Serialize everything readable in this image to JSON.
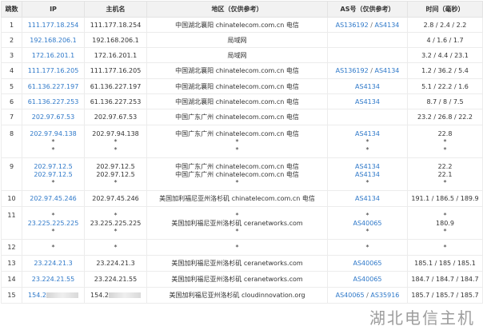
{
  "headers": [
    "跳数",
    "IP",
    "主机名",
    "地区（仅供参考）",
    "AS号（仅供参考）",
    "时间（毫秒）"
  ],
  "rows": [
    {
      "hop": "1",
      "ips": [
        "111.177.18.254"
      ],
      "hosts": [
        "111.177.18.254"
      ],
      "regions": [
        "中国湖北襄阳 chinatelecom.com.cn 电信"
      ],
      "as_lines": [
        [
          "AS136192",
          "AS4134"
        ]
      ],
      "times": [
        "2.8 / 2.4 / 2.2"
      ]
    },
    {
      "hop": "2",
      "ips": [
        "192.168.206.1"
      ],
      "hosts": [
        "192.168.206.1"
      ],
      "regions": [
        "局域网"
      ],
      "as_lines": [],
      "times": [
        "4 / 1.6 / 1.7"
      ]
    },
    {
      "hop": "3",
      "ips": [
        "172.16.201.1"
      ],
      "hosts": [
        "172.16.201.1"
      ],
      "regions": [
        "局域网"
      ],
      "as_lines": [],
      "times": [
        "3.2 / 4.4 / 23.1"
      ]
    },
    {
      "hop": "4",
      "ips": [
        "111.177.16.205"
      ],
      "hosts": [
        "111.177.16.205"
      ],
      "regions": [
        "中国湖北襄阳 chinatelecom.com.cn 电信"
      ],
      "as_lines": [
        [
          "AS136192",
          "AS4134"
        ]
      ],
      "times": [
        "1.2 / 36.2 / 5.4"
      ]
    },
    {
      "hop": "5",
      "ips": [
        "61.136.227.197"
      ],
      "hosts": [
        "61.136.227.197"
      ],
      "regions": [
        "中国湖北襄阳 chinatelecom.com.cn 电信"
      ],
      "as_lines": [
        [
          "AS4134"
        ]
      ],
      "times": [
        "5.1 / 22.2 / 1.6"
      ]
    },
    {
      "hop": "6",
      "ips": [
        "61.136.227.253"
      ],
      "hosts": [
        "61.136.227.253"
      ],
      "regions": [
        "中国湖北襄阳 chinatelecom.com.cn 电信"
      ],
      "as_lines": [
        [
          "AS4134"
        ]
      ],
      "times": [
        "8.7 / 8 / 7.5"
      ]
    },
    {
      "hop": "7",
      "ips": [
        "202.97.67.53"
      ],
      "hosts": [
        "202.97.67.53"
      ],
      "regions": [
        "中国广东广州 chinatelecom.com.cn 电信"
      ],
      "as_lines": [],
      "times": [
        "23.2 / 26.8 / 22.2"
      ]
    },
    {
      "hop": "8",
      "ips": [
        "202.97.94.138",
        "*",
        "*"
      ],
      "hosts": [
        "202.97.94.138",
        "*",
        "*"
      ],
      "regions": [
        "中国广东广州 chinatelecom.com.cn 电信",
        "*",
        "*"
      ],
      "as_lines": [
        [
          "AS4134"
        ],
        [
          "*"
        ],
        [
          "*"
        ]
      ],
      "times": [
        "22.8",
        "*",
        "*"
      ]
    },
    {
      "hop": "9",
      "ips": [
        "202.97.12.5",
        "202.97.12.5",
        "*"
      ],
      "hosts": [
        "202.97.12.5",
        "202.97.12.5",
        "*"
      ],
      "regions": [
        "中国广东广州 chinatelecom.com.cn 电信",
        "中国广东广州 chinatelecom.com.cn 电信",
        "*"
      ],
      "as_lines": [
        [
          "AS4134"
        ],
        [
          "AS4134"
        ],
        [
          "*"
        ]
      ],
      "times": [
        "22.2",
        "22.1",
        "*"
      ]
    },
    {
      "hop": "10",
      "ips": [
        "202.97.45.246"
      ],
      "hosts": [
        "202.97.45.246"
      ],
      "regions": [
        "美国加利福尼亚州洛杉矶 chinatelecom.com.cn 电信"
      ],
      "as_lines": [
        [
          "AS4134"
        ]
      ],
      "times": [
        "191.1 / 186.5 / 189.9"
      ]
    },
    {
      "hop": "11",
      "ips": [
        "*",
        "23.225.225.225",
        "*"
      ],
      "hosts": [
        "*",
        "23.225.225.225",
        "*"
      ],
      "regions": [
        "*",
        "美国加利福尼亚州洛杉矶 ceranetworks.com",
        "*"
      ],
      "as_lines": [
        [
          "*"
        ],
        [
          "AS40065"
        ],
        [
          "*"
        ]
      ],
      "times": [
        "*",
        "180.9",
        "*"
      ]
    },
    {
      "hop": "12",
      "ips": [
        "*"
      ],
      "hosts": [
        "*"
      ],
      "regions": [
        "*"
      ],
      "as_lines": [
        [
          "*"
        ]
      ],
      "times": [
        "*"
      ]
    },
    {
      "hop": "13",
      "ips": [
        "23.224.21.3"
      ],
      "hosts": [
        "23.224.21.3"
      ],
      "regions": [
        "美国加利福尼亚州洛杉矶 ceranetworks.com"
      ],
      "as_lines": [
        [
          "AS40065"
        ]
      ],
      "times": [
        "185.1 / 185 / 185.1"
      ]
    },
    {
      "hop": "14",
      "ips": [
        "23.224.21.55"
      ],
      "hosts": [
        "23.224.21.55"
      ],
      "regions": [
        "美国加利福尼亚州洛杉矶 ceranetworks.com"
      ],
      "as_lines": [
        [
          "AS40065"
        ]
      ],
      "times": [
        "184.7 / 184.7 / 184.7"
      ]
    },
    {
      "hop": "15",
      "ips": [
        "154.2"
      ],
      "hosts": [
        "154.2"
      ],
      "regions": [
        "美国加利福尼亚州洛杉矶 cloudinnovation.org"
      ],
      "as_lines": [
        [
          "AS40065",
          "AS35916"
        ]
      ],
      "times": [
        "185.7 / 185.7 / 185.7"
      ],
      "masked": true
    }
  ],
  "row_line_counts": [
    1,
    1,
    1,
    1,
    1,
    1,
    1,
    3,
    3,
    1,
    3,
    1,
    1,
    1,
    1
  ],
  "watermark": "湖北电信主机"
}
